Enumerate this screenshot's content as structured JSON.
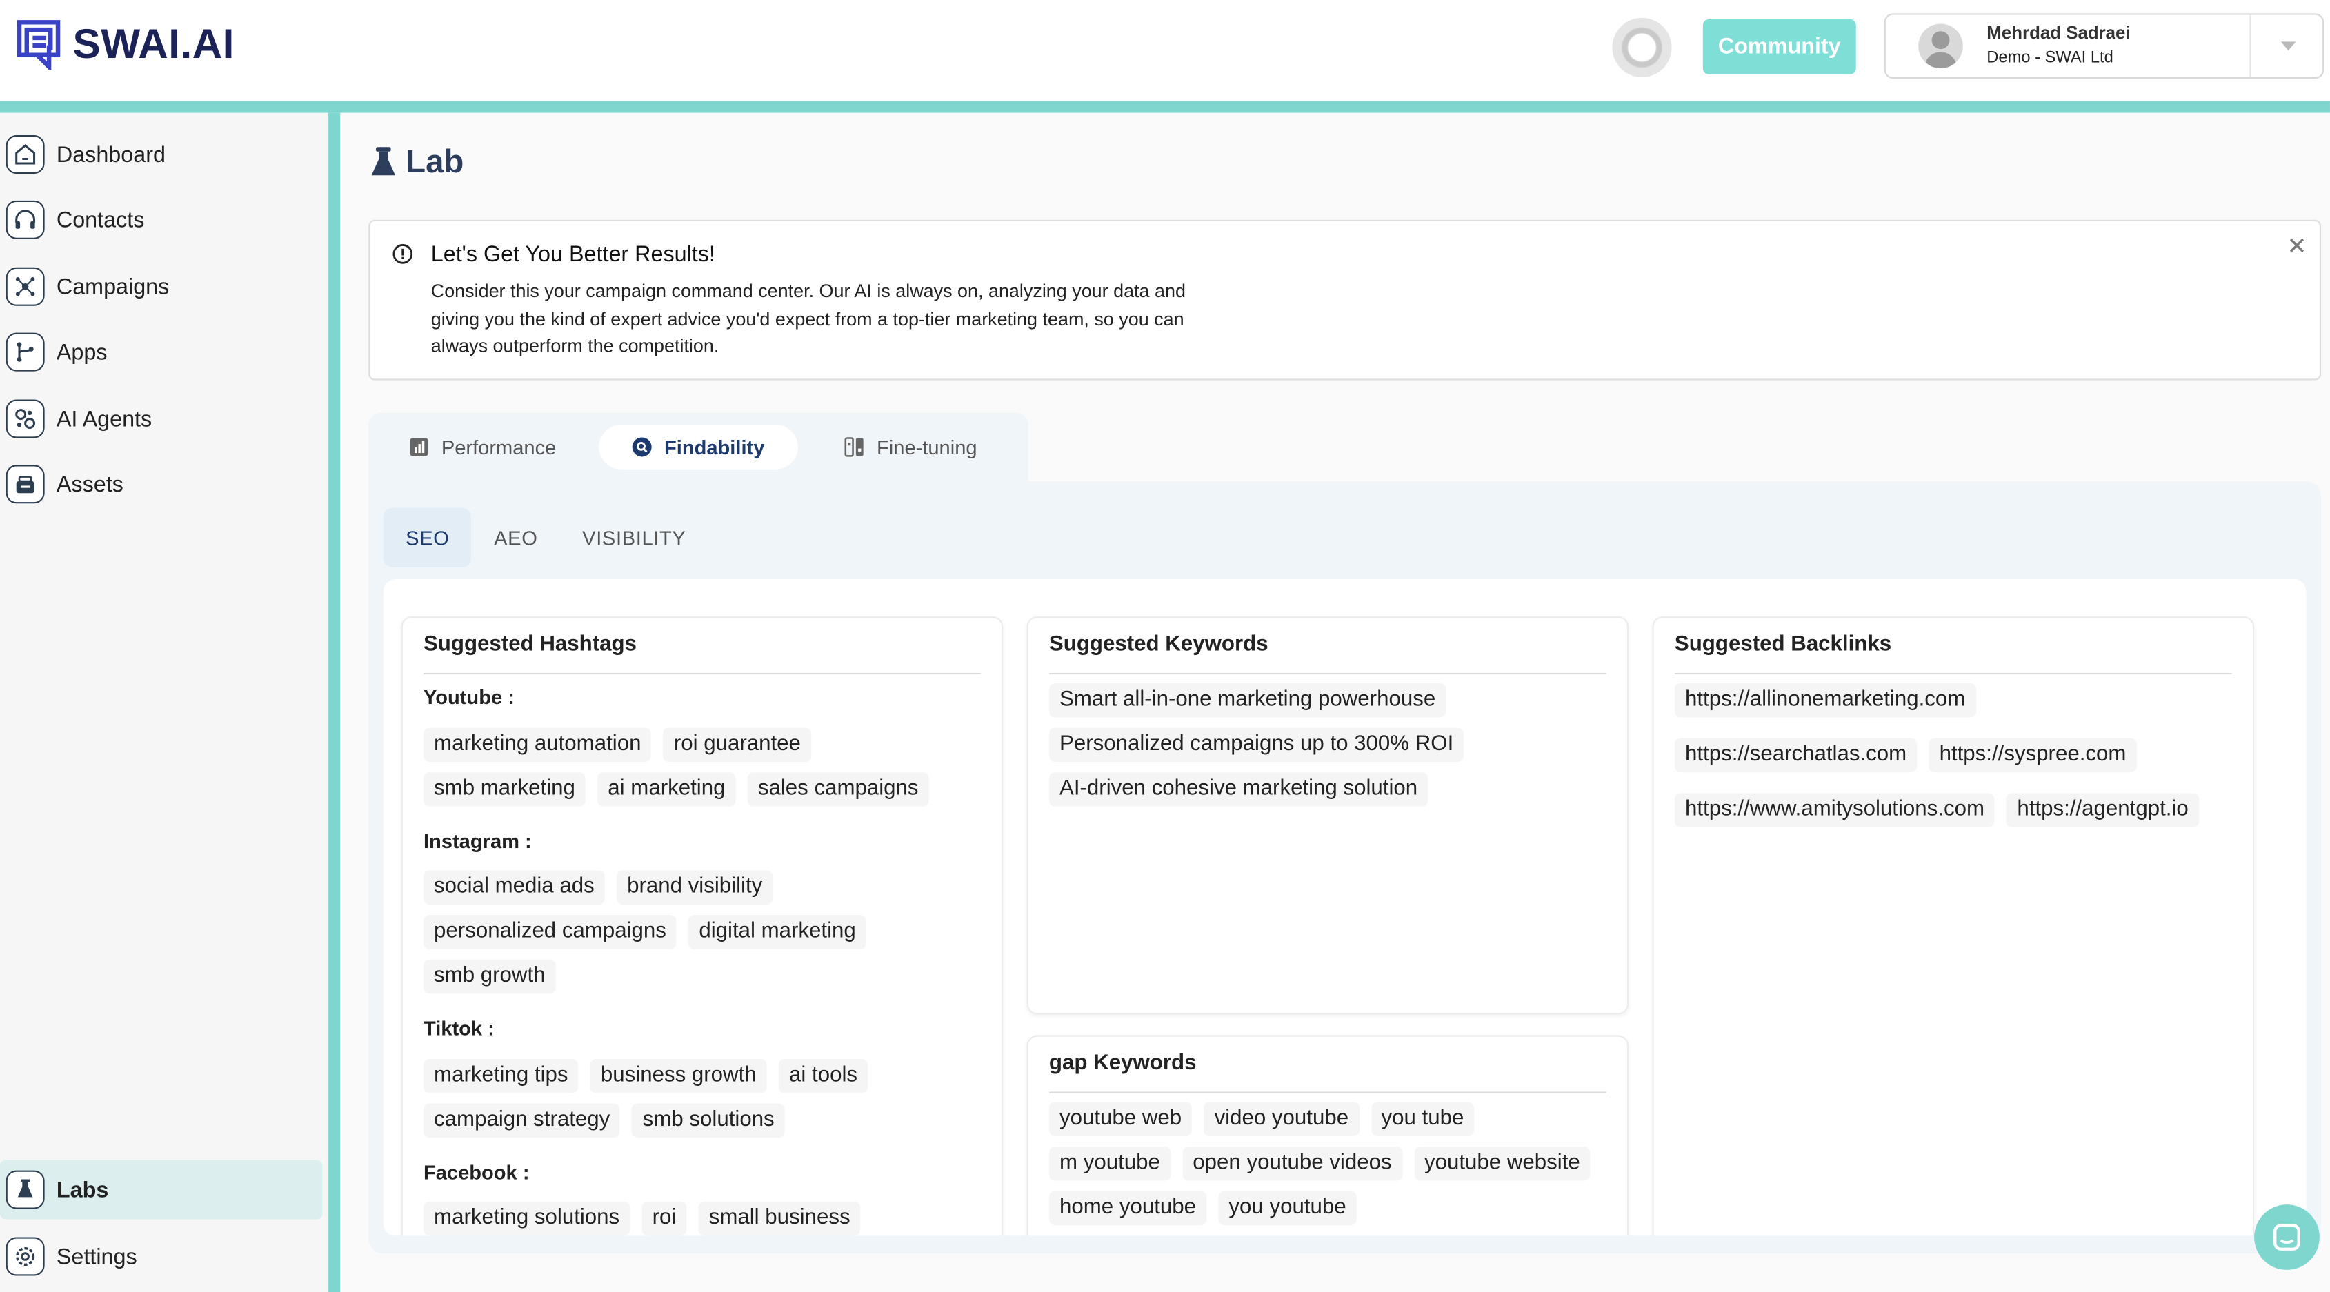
{
  "brand": {
    "name": "SWAI.AI"
  },
  "header": {
    "community_label": "Community",
    "user_name": "Mehrdad Sadraei",
    "user_org": "Demo - SWAI Ltd"
  },
  "sidebar": {
    "items": [
      {
        "label": "Dashboard",
        "icon": "home-icon"
      },
      {
        "label": "Contacts",
        "icon": "headset-icon"
      },
      {
        "label": "Campaigns",
        "icon": "network-icon"
      },
      {
        "label": "Apps",
        "icon": "branch-icon"
      },
      {
        "label": "AI Agents",
        "icon": "agents-icon"
      },
      {
        "label": "Assets",
        "icon": "assets-icon"
      }
    ],
    "bottom": [
      {
        "label": "Labs",
        "icon": "flask-icon",
        "active": true
      },
      {
        "label": "Settings",
        "icon": "gear-icon"
      }
    ]
  },
  "page": {
    "title": "Lab"
  },
  "alert": {
    "title": "Let's Get You Better Results!",
    "body": "Consider this your campaign command center. Our AI is always on, analyzing your data and giving you the kind of expert advice you'd expect from a top-tier marketing team, so you can always outperform the competition."
  },
  "tabs": [
    {
      "label": "Performance"
    },
    {
      "label": "Findability",
      "active": true
    },
    {
      "label": "Fine-tuning"
    }
  ],
  "subtabs": [
    {
      "label": "SEO",
      "active": true
    },
    {
      "label": "AEO"
    },
    {
      "label": "VISIBILITY"
    }
  ],
  "hashtags": {
    "title": "Suggested Hashtags",
    "groups": [
      {
        "label": "Youtube :",
        "tags": [
          "marketing automation",
          "roi guarantee",
          "smb marketing",
          "ai marketing",
          "sales campaigns"
        ]
      },
      {
        "label": "Instagram :",
        "tags": [
          "social media ads",
          "brand visibility",
          "personalized campaigns",
          "digital marketing",
          "smb growth"
        ]
      },
      {
        "label": "Tiktok :",
        "tags": [
          "marketing tips",
          "business growth",
          "ai tools",
          "campaign strategy",
          "smb solutions"
        ]
      },
      {
        "label": "Facebook :",
        "tags": [
          "marketing solutions",
          "roi",
          "small business"
        ]
      }
    ]
  },
  "keywords": {
    "title": "Suggested Keywords",
    "items": [
      "Smart all-in-one marketing powerhouse",
      "Personalized campaigns up to 300% ROI",
      "AI-driven cohesive marketing solution"
    ]
  },
  "gap": {
    "title": "gap Keywords",
    "items": [
      "youtube web",
      "video youtube",
      "you tube",
      "m youtube",
      "open youtube videos",
      "youtube website",
      "home youtube",
      "you youtube"
    ]
  },
  "backlinks": {
    "title": "Suggested Backlinks",
    "items": [
      "https://allinonemarketing.com",
      "https://searchatlas.com",
      "https://syspree.com",
      "https://www.amitysolutions.com",
      "https://agentgpt.io"
    ]
  },
  "colors": {
    "accent": "#7fd6cf",
    "brand": "#1a2256",
    "active_tab": "#1d3a6e"
  }
}
